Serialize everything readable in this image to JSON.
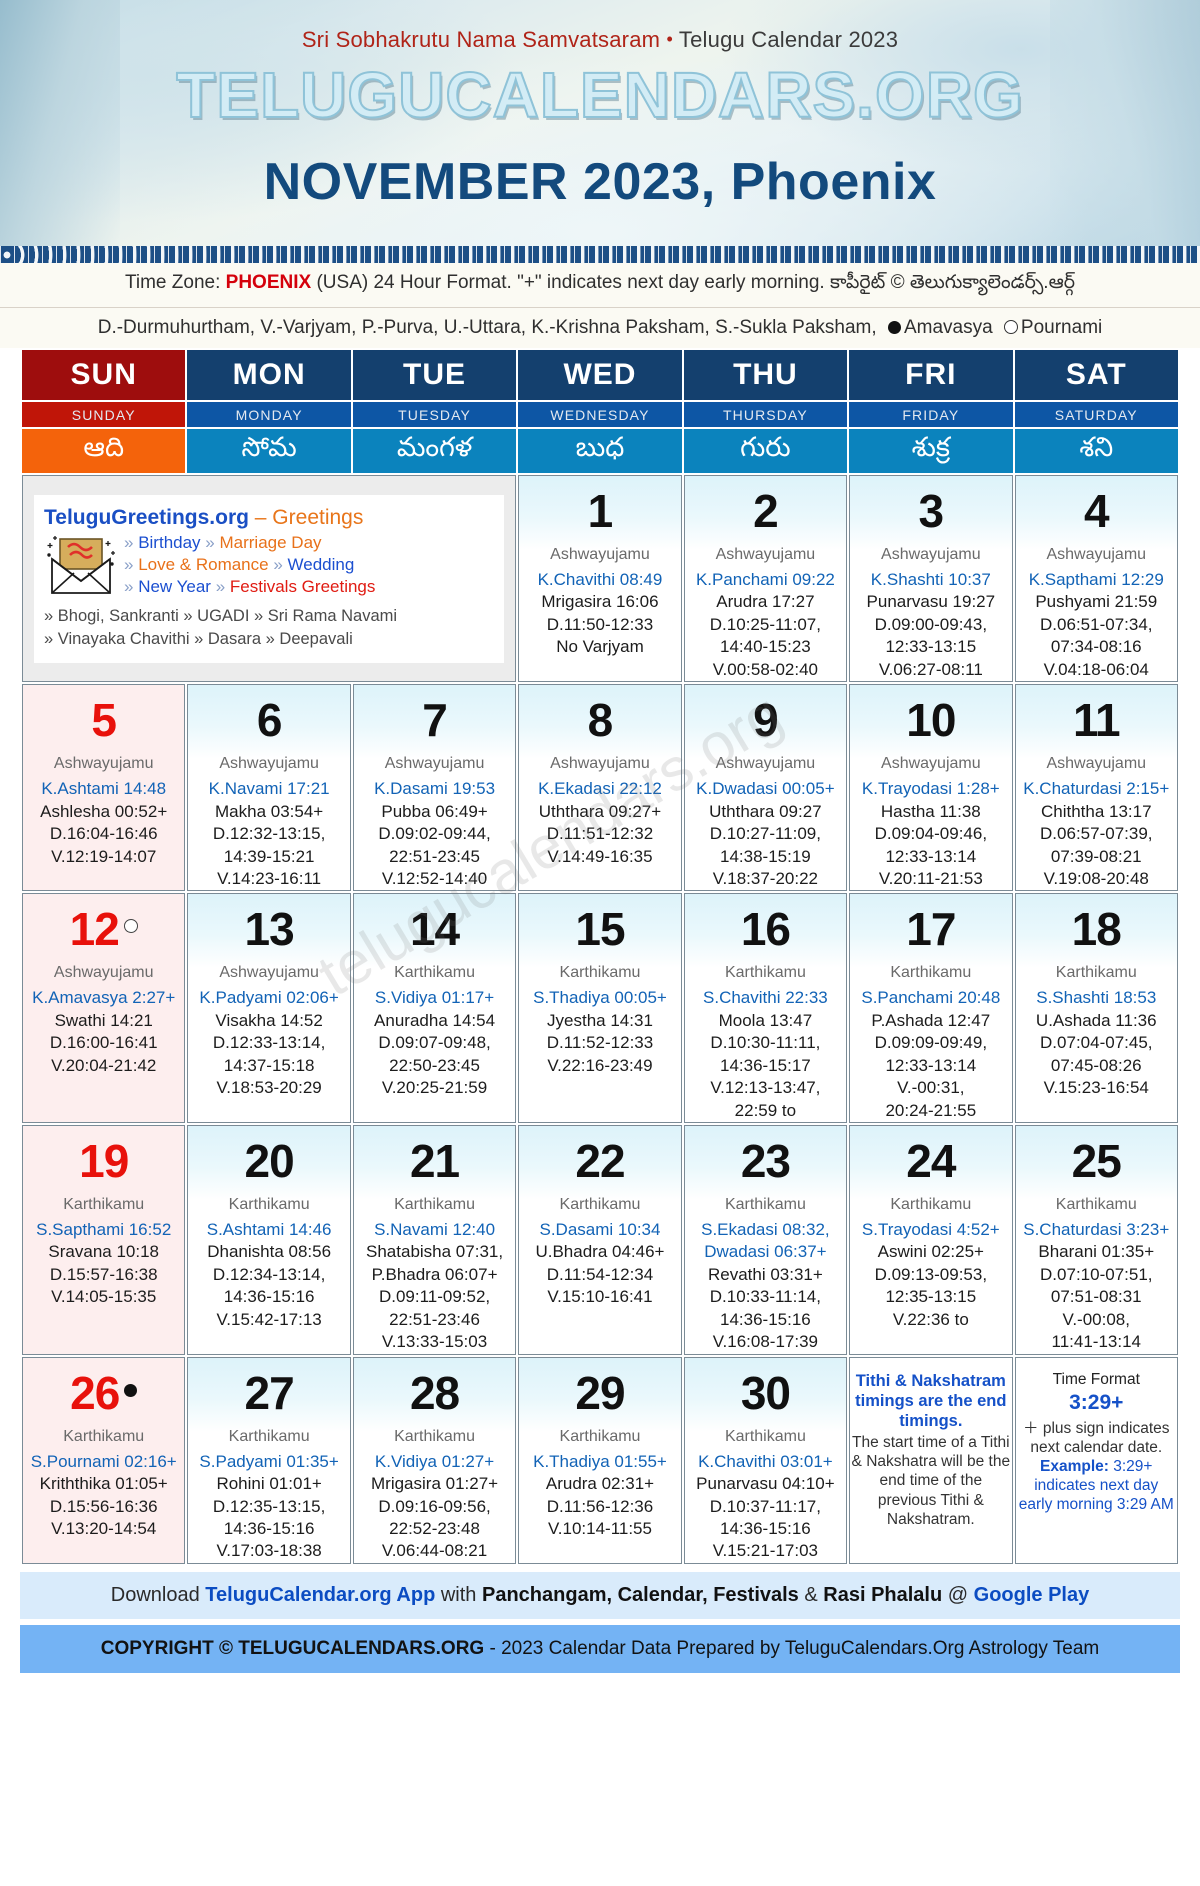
{
  "header": {
    "samvatsaram": "Sri Sobhakrutu Nama Samvatsaram",
    "separator": "•",
    "calendar_year_label": "Telugu Calendar 2023",
    "site_name": "TELUGUCALENDARS.ORG",
    "month_title": "NOVEMBER 2023, Phoenix"
  },
  "info": {
    "timezone_prefix": "Time Zone:",
    "timezone_city": "PHOENIX",
    "timezone_rest": "(USA) 24 Hour Format. \"+\" indicates next day early morning.",
    "copyright_telugu": "కాపీరైట్ © తెలుగుక్యాలెండర్స్.ఆర్గ్",
    "abbrev_line": "D.-Durmuhurtham, V.-Varjyam, P.-Purva, U.-Uttara, K.-Krishna Paksham, S.-Sukla Paksham,",
    "amavasya_label": "Amavasya",
    "pournami_label": "Pournami"
  },
  "weekdays": [
    {
      "short": "SUN",
      "long": "SUNDAY",
      "telugu": "ఆది"
    },
    {
      "short": "MON",
      "long": "MONDAY",
      "telugu": "సోమ"
    },
    {
      "short": "TUE",
      "long": "TUESDAY",
      "telugu": "మంగళ"
    },
    {
      "short": "WED",
      "long": "WEDNESDAY",
      "telugu": "బుధ"
    },
    {
      "short": "THU",
      "long": "THURSDAY",
      "telugu": "గురు"
    },
    {
      "short": "FRI",
      "long": "FRIDAY",
      "telugu": "శుక్ర"
    },
    {
      "short": "SAT",
      "long": "SATURDAY",
      "telugu": "శని"
    }
  ],
  "promo": {
    "title": "TeluguGreetings.org",
    "title_suffix": "– Greetings",
    "icon": "envelope-greeting-icon",
    "links": [
      [
        {
          "t": "Birthday",
          "c": "blue"
        },
        {
          "t": "Marriage Day",
          "c": "orange"
        }
      ],
      [
        {
          "t": "Love & Romance",
          "c": "orange"
        },
        {
          "t": "Wedding",
          "c": "blue"
        }
      ],
      [
        {
          "t": "New Year",
          "c": "blue"
        },
        {
          "t": "Festivals Greetings",
          "c": "red"
        }
      ]
    ],
    "footer_line1": "» Bhogi, Sankranti » UGADI » Sri Rama Navami",
    "footer_line2": "» Vinayaka Chavithi » Dasara » Deepavali"
  },
  "notes": {
    "tithi_note": {
      "bold": "Tithi & Nakshatram timings are the end timings.",
      "plain": "The start time of a Tithi & Nakshatra will be the end time of the previous Tithi & Nakshatram."
    },
    "time_format": {
      "heading": "Time Format",
      "example_big": "3:29+",
      "line1": "＋ plus sign indicates next calendar date.",
      "line2_label": "Example:",
      "line2": "3:29+ indicates next day early morning 3:29 AM"
    }
  },
  "footer": {
    "download_pre": "Download",
    "app_name": "TeluguCalendar.org App",
    "download_mid": "with",
    "features": "Panchangam, Calendar, Festivals",
    "amp": "&",
    "features2": "Rasi Phalalu",
    "at": "@",
    "store": "Google Play",
    "copyright_bold": "COPYRIGHT © TELUGUCALENDARS.ORG",
    "copyright_rest": "- 2023 Calendar Data Prepared by TeluguCalendars.Org Astrology Team"
  },
  "watermark": "telugucalendars.org",
  "colors": {
    "sunday_header": "#9e0d0d",
    "weekday_header": "#14406e",
    "telugu_row": "#0b83bd",
    "sunday_telugu": "#f4630b",
    "month_title": "#134a7d",
    "tithi_blue": "#1263b6",
    "sunday_date": "#e8110b"
  },
  "weeks": [
    [
      {
        "type": "promo"
      },
      {
        "date": "1",
        "masa": "Ashwayujamu",
        "tithi": "K.Chavithi 08:49",
        "lines": [
          "Mrigasira 16:06",
          "D.11:50-12:33",
          "No Varjyam"
        ]
      },
      {
        "date": "2",
        "masa": "Ashwayujamu",
        "tithi": "K.Panchami 09:22",
        "lines": [
          "Arudra 17:27",
          "D.10:25-11:07,",
          "14:40-15:23",
          "V.00:58-02:40"
        ]
      },
      {
        "date": "3",
        "masa": "Ashwayujamu",
        "tithi": "K.Shashti 10:37",
        "lines": [
          "Punarvasu 19:27",
          "D.09:00-09:43,",
          "12:33-13:15",
          "V.06:27-08:11"
        ]
      },
      {
        "date": "4",
        "masa": "Ashwayujamu",
        "tithi": "K.Sapthami 12:29",
        "lines": [
          "Pushyami 21:59",
          "D.06:51-07:34,",
          "07:34-08:16",
          "V.04:18-06:04"
        ]
      }
    ],
    [
      {
        "date": "5",
        "sunday": true,
        "masa": "Ashwayujamu",
        "tithi": "K.Ashtami 14:48",
        "lines": [
          "Ashlesha 00:52+",
          "D.16:04-16:46",
          "V.12:19-14:07"
        ]
      },
      {
        "date": "6",
        "masa": "Ashwayujamu",
        "tithi": "K.Navami 17:21",
        "lines": [
          "Makha 03:54+",
          "D.12:32-13:15,",
          "14:39-15:21",
          "V.14:23-16:11"
        ]
      },
      {
        "date": "7",
        "masa": "Ashwayujamu",
        "tithi": "K.Dasami 19:53",
        "lines": [
          "Pubba 06:49+",
          "D.09:02-09:44,",
          "22:51-23:45",
          "V.12:52-14:40"
        ]
      },
      {
        "date": "8",
        "masa": "Ashwayujamu",
        "tithi": "K.Ekadasi 22:12",
        "lines": [
          "Uththara 09:27+",
          "D.11:51-12:32",
          "V.14:49-16:35"
        ]
      },
      {
        "date": "9",
        "masa": "Ashwayujamu",
        "tithi": "K.Dwadasi 00:05+",
        "lines": [
          "Uththara 09:27",
          "D.10:27-11:09,",
          "14:38-15:19",
          "V.18:37-20:22"
        ]
      },
      {
        "date": "10",
        "masa": "Ashwayujamu",
        "tithi": "K.Trayodasi 1:28+",
        "lines": [
          "Hastha 11:38",
          "D.09:04-09:46,",
          "12:33-13:14",
          "V.20:11-21:53"
        ]
      },
      {
        "date": "11",
        "masa": "Ashwayujamu",
        "tithi": "K.Chaturdasi 2:15+",
        "lines": [
          "Chiththa 13:17",
          "D.06:57-07:39,",
          "07:39-08:21",
          "V.19:08-20:48"
        ]
      }
    ],
    [
      {
        "date": "12",
        "sunday": true,
        "moon": "new",
        "masa": "Ashwayujamu",
        "tithi": "K.Amavasya 2:27+",
        "lines": [
          "Swathi 14:21",
          "D.16:00-16:41",
          "V.20:04-21:42"
        ]
      },
      {
        "date": "13",
        "masa": "Ashwayujamu",
        "tithi": "K.Padyami 02:06+",
        "lines": [
          "Visakha 14:52",
          "D.12:33-13:14,",
          "14:37-15:18",
          "V.18:53-20:29"
        ]
      },
      {
        "date": "14",
        "masa": "Karthikamu",
        "tithi": "S.Vidiya 01:17+",
        "lines": [
          "Anuradha 14:54",
          "D.09:07-09:48,",
          "22:50-23:45",
          "V.20:25-21:59"
        ]
      },
      {
        "date": "15",
        "masa": "Karthikamu",
        "tithi": "S.Thadiya 00:05+",
        "lines": [
          "Jyestha 14:31",
          "D.11:52-12:33",
          "V.22:16-23:49"
        ]
      },
      {
        "date": "16",
        "masa": "Karthikamu",
        "tithi": "S.Chavithi 22:33",
        "lines": [
          "Moola 13:47",
          "D.10:30-11:11,",
          "14:36-15:17",
          "V.12:13-13:47,",
          "22:59 to"
        ]
      },
      {
        "date": "17",
        "masa": "Karthikamu",
        "tithi": "S.Panchami 20:48",
        "lines": [
          "P.Ashada 12:47",
          "D.09:09-09:49,",
          "12:33-13:14",
          "V.-00:31,",
          "20:24-21:55"
        ]
      },
      {
        "date": "18",
        "masa": "Karthikamu",
        "tithi": "S.Shashti 18:53",
        "lines": [
          "U.Ashada 11:36",
          "D.07:04-07:45,",
          "07:45-08:26",
          "V.15:23-16:54"
        ]
      }
    ],
    [
      {
        "date": "19",
        "sunday": true,
        "masa": "Karthikamu",
        "tithi": "S.Sapthami 16:52",
        "lines": [
          "Sravana 10:18",
          "D.15:57-16:38",
          "V.14:05-15:35"
        ]
      },
      {
        "date": "20",
        "masa": "Karthikamu",
        "tithi": "S.Ashtami 14:46",
        "lines": [
          "Dhanishta 08:56",
          "D.12:34-13:14,",
          "14:36-15:16",
          "V.15:42-17:13"
        ]
      },
      {
        "date": "21",
        "masa": "Karthikamu",
        "tithi": "S.Navami 12:40",
        "lines": [
          "Shatabisha 07:31,",
          "P.Bhadra 06:07+",
          "D.09:11-09:52,",
          "22:51-23:46",
          "V.13:33-15:03"
        ]
      },
      {
        "date": "22",
        "masa": "Karthikamu",
        "tithi": "S.Dasami 10:34",
        "lines": [
          "U.Bhadra 04:46+",
          "D.11:54-12:34",
          "V.15:10-16:41"
        ]
      },
      {
        "date": "23",
        "masa": "Karthikamu",
        "tithi": "S.Ekadasi 08:32, Dwadasi 06:37+",
        "lines": [
          "Revathi 03:31+",
          "D.10:33-11:14,",
          "14:36-15:16",
          "V.16:08-17:39"
        ]
      },
      {
        "date": "24",
        "masa": "Karthikamu",
        "tithi": "S.Trayodasi 4:52+",
        "lines": [
          "Aswini 02:25+",
          "D.09:13-09:53,",
          "12:35-13:15",
          "V.22:36 to"
        ]
      },
      {
        "date": "25",
        "masa": "Karthikamu",
        "tithi": "S.Chaturdasi 3:23+",
        "lines": [
          "Bharani 01:35+",
          "D.07:10-07:51,",
          "07:51-08:31",
          "V.-00:08,",
          "11:41-13:14"
        ]
      }
    ],
    [
      {
        "date": "26",
        "sunday": true,
        "moon": "full",
        "masa": "Karthikamu",
        "tithi": "S.Pournami 02:16+",
        "lines": [
          "Kriththika 01:05+",
          "D.15:56-16:36",
          "V.13:20-14:54"
        ]
      },
      {
        "date": "27",
        "masa": "Karthikamu",
        "tithi": "S.Padyami 01:35+",
        "lines": [
          "Rohini 01:01+",
          "D.12:35-13:15,",
          "14:36-15:16",
          "V.17:03-18:38"
        ]
      },
      {
        "date": "28",
        "masa": "Karthikamu",
        "tithi": "K.Vidiya 01:27+",
        "lines": [
          "Mrigasira 01:27+",
          "D.09:16-09:56,",
          "22:52-23:48",
          "V.06:44-08:21"
        ]
      },
      {
        "date": "29",
        "masa": "Karthikamu",
        "tithi": "K.Thadiya 01:55+",
        "lines": [
          "Arudra 02:31+",
          "D.11:56-12:36",
          "V.10:14-11:55"
        ]
      },
      {
        "date": "30",
        "masa": "Karthikamu",
        "tithi": "K.Chavithi 03:01+",
        "lines": [
          "Punarvasu 04:10+",
          "D.10:37-11:17,",
          "14:36-15:16",
          "V.15:21-17:03"
        ]
      },
      {
        "type": "note-tithi"
      },
      {
        "type": "note-timeformat"
      }
    ]
  ]
}
